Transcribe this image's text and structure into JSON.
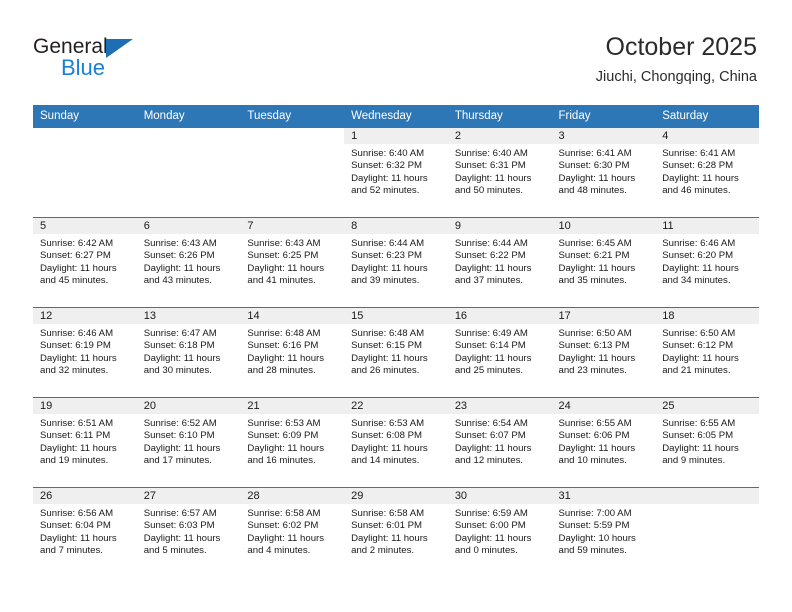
{
  "branding": {
    "name_part1": "General",
    "name_part2": "Blue",
    "triangle_color": "#1c6fb5",
    "blue_color": "#1c7fd6"
  },
  "header": {
    "title": "October 2025",
    "subtitle": "Jiuchi, Chongqing, China"
  },
  "theme": {
    "header_blue": "#2e77b7",
    "daynum_band": "#efefef",
    "text": "#1a1a1a"
  },
  "day_names": [
    "Sunday",
    "Monday",
    "Tuesday",
    "Wednesday",
    "Thursday",
    "Friday",
    "Saturday"
  ],
  "labels": {
    "sunrise_prefix": "Sunrise:",
    "sunset_prefix": "Sunset:",
    "daylight_prefix": "Daylight:"
  },
  "weeks": [
    [
      {
        "blank": true
      },
      {
        "blank": true
      },
      {
        "blank": true
      },
      {
        "day": "1",
        "line1": "Sunrise: 6:40 AM",
        "line2": "Sunset: 6:32 PM",
        "line3": "Daylight: 11 hours",
        "line4": "and 52 minutes."
      },
      {
        "day": "2",
        "line1": "Sunrise: 6:40 AM",
        "line2": "Sunset: 6:31 PM",
        "line3": "Daylight: 11 hours",
        "line4": "and 50 minutes."
      },
      {
        "day": "3",
        "line1": "Sunrise: 6:41 AM",
        "line2": "Sunset: 6:30 PM",
        "line3": "Daylight: 11 hours",
        "line4": "and 48 minutes."
      },
      {
        "day": "4",
        "line1": "Sunrise: 6:41 AM",
        "line2": "Sunset: 6:28 PM",
        "line3": "Daylight: 11 hours",
        "line4": "and 46 minutes."
      }
    ],
    [
      {
        "day": "5",
        "line1": "Sunrise: 6:42 AM",
        "line2": "Sunset: 6:27 PM",
        "line3": "Daylight: 11 hours",
        "line4": "and 45 minutes."
      },
      {
        "day": "6",
        "line1": "Sunrise: 6:43 AM",
        "line2": "Sunset: 6:26 PM",
        "line3": "Daylight: 11 hours",
        "line4": "and 43 minutes."
      },
      {
        "day": "7",
        "line1": "Sunrise: 6:43 AM",
        "line2": "Sunset: 6:25 PM",
        "line3": "Daylight: 11 hours",
        "line4": "and 41 minutes."
      },
      {
        "day": "8",
        "line1": "Sunrise: 6:44 AM",
        "line2": "Sunset: 6:23 PM",
        "line3": "Daylight: 11 hours",
        "line4": "and 39 minutes."
      },
      {
        "day": "9",
        "line1": "Sunrise: 6:44 AM",
        "line2": "Sunset: 6:22 PM",
        "line3": "Daylight: 11 hours",
        "line4": "and 37 minutes."
      },
      {
        "day": "10",
        "line1": "Sunrise: 6:45 AM",
        "line2": "Sunset: 6:21 PM",
        "line3": "Daylight: 11 hours",
        "line4": "and 35 minutes."
      },
      {
        "day": "11",
        "line1": "Sunrise: 6:46 AM",
        "line2": "Sunset: 6:20 PM",
        "line3": "Daylight: 11 hours",
        "line4": "and 34 minutes."
      }
    ],
    [
      {
        "day": "12",
        "line1": "Sunrise: 6:46 AM",
        "line2": "Sunset: 6:19 PM",
        "line3": "Daylight: 11 hours",
        "line4": "and 32 minutes."
      },
      {
        "day": "13",
        "line1": "Sunrise: 6:47 AM",
        "line2": "Sunset: 6:18 PM",
        "line3": "Daylight: 11 hours",
        "line4": "and 30 minutes."
      },
      {
        "day": "14",
        "line1": "Sunrise: 6:48 AM",
        "line2": "Sunset: 6:16 PM",
        "line3": "Daylight: 11 hours",
        "line4": "and 28 minutes."
      },
      {
        "day": "15",
        "line1": "Sunrise: 6:48 AM",
        "line2": "Sunset: 6:15 PM",
        "line3": "Daylight: 11 hours",
        "line4": "and 26 minutes."
      },
      {
        "day": "16",
        "line1": "Sunrise: 6:49 AM",
        "line2": "Sunset: 6:14 PM",
        "line3": "Daylight: 11 hours",
        "line4": "and 25 minutes."
      },
      {
        "day": "17",
        "line1": "Sunrise: 6:50 AM",
        "line2": "Sunset: 6:13 PM",
        "line3": "Daylight: 11 hours",
        "line4": "and 23 minutes."
      },
      {
        "day": "18",
        "line1": "Sunrise: 6:50 AM",
        "line2": "Sunset: 6:12 PM",
        "line3": "Daylight: 11 hours",
        "line4": "and 21 minutes."
      }
    ],
    [
      {
        "day": "19",
        "line1": "Sunrise: 6:51 AM",
        "line2": "Sunset: 6:11 PM",
        "line3": "Daylight: 11 hours",
        "line4": "and 19 minutes."
      },
      {
        "day": "20",
        "line1": "Sunrise: 6:52 AM",
        "line2": "Sunset: 6:10 PM",
        "line3": "Daylight: 11 hours",
        "line4": "and 17 minutes."
      },
      {
        "day": "21",
        "line1": "Sunrise: 6:53 AM",
        "line2": "Sunset: 6:09 PM",
        "line3": "Daylight: 11 hours",
        "line4": "and 16 minutes."
      },
      {
        "day": "22",
        "line1": "Sunrise: 6:53 AM",
        "line2": "Sunset: 6:08 PM",
        "line3": "Daylight: 11 hours",
        "line4": "and 14 minutes."
      },
      {
        "day": "23",
        "line1": "Sunrise: 6:54 AM",
        "line2": "Sunset: 6:07 PM",
        "line3": "Daylight: 11 hours",
        "line4": "and 12 minutes."
      },
      {
        "day": "24",
        "line1": "Sunrise: 6:55 AM",
        "line2": "Sunset: 6:06 PM",
        "line3": "Daylight: 11 hours",
        "line4": "and 10 minutes."
      },
      {
        "day": "25",
        "line1": "Sunrise: 6:55 AM",
        "line2": "Sunset: 6:05 PM",
        "line3": "Daylight: 11 hours",
        "line4": "and 9 minutes."
      }
    ],
    [
      {
        "day": "26",
        "line1": "Sunrise: 6:56 AM",
        "line2": "Sunset: 6:04 PM",
        "line3": "Daylight: 11 hours",
        "line4": "and 7 minutes."
      },
      {
        "day": "27",
        "line1": "Sunrise: 6:57 AM",
        "line2": "Sunset: 6:03 PM",
        "line3": "Daylight: 11 hours",
        "line4": "and 5 minutes."
      },
      {
        "day": "28",
        "line1": "Sunrise: 6:58 AM",
        "line2": "Sunset: 6:02 PM",
        "line3": "Daylight: 11 hours",
        "line4": "and 4 minutes."
      },
      {
        "day": "29",
        "line1": "Sunrise: 6:58 AM",
        "line2": "Sunset: 6:01 PM",
        "line3": "Daylight: 11 hours",
        "line4": "and 2 minutes."
      },
      {
        "day": "30",
        "line1": "Sunrise: 6:59 AM",
        "line2": "Sunset: 6:00 PM",
        "line3": "Daylight: 11 hours",
        "line4": "and 0 minutes."
      },
      {
        "day": "31",
        "line1": "Sunrise: 7:00 AM",
        "line2": "Sunset: 5:59 PM",
        "line3": "Daylight: 10 hours",
        "line4": "and 59 minutes."
      },
      {
        "day": "",
        "line1": "",
        "line2": "",
        "line3": "",
        "line4": ""
      }
    ]
  ]
}
